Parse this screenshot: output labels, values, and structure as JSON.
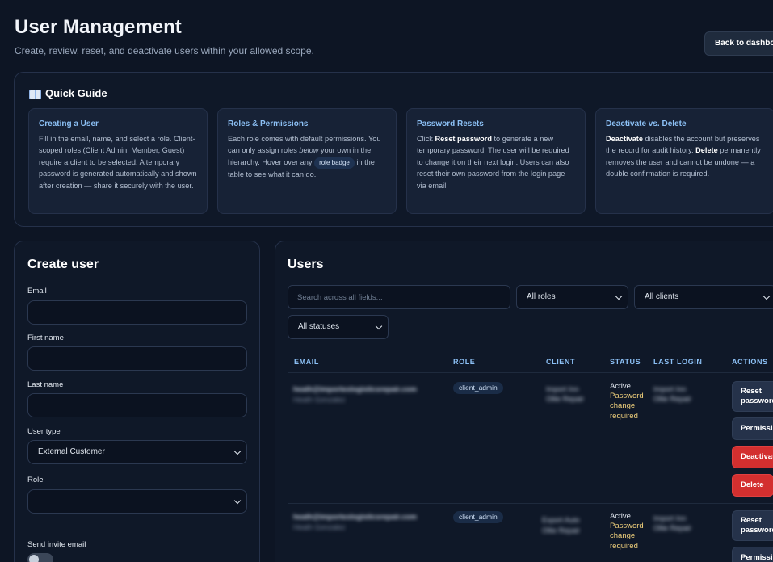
{
  "header": {
    "title": "User Management",
    "subtitle": "Create, review, reset, and deactivate users within your allowed scope.",
    "back_label": "Back to dashboard"
  },
  "guide": {
    "heading": "Quick Guide",
    "icon": "book-icon",
    "cards": [
      {
        "title": "Creating a User",
        "text": "Fill in the email, name, and select a role. Client-scoped roles (Client Admin, Member, Guest) require a client to be selected. A temporary password is generated automatically and shown after creation — share it securely with the user."
      },
      {
        "title": "Roles & Permissions",
        "text_a": "Each role comes with default permissions. You can only assign roles ",
        "text_em": "below",
        "text_b": " your own in the hierarchy. Hover over any ",
        "chip": "role badge",
        "text_c": " in the table to see what it can do."
      },
      {
        "title": "Password Resets",
        "text_a": "Click ",
        "text_bold": "Reset password",
        "text_b": " to generate a new temporary password. The user will be required to change it on their next login. Users can also reset their own password from the login page via email."
      },
      {
        "title": "Deactivate vs. Delete",
        "bold_a": "Deactivate",
        "text_a": " disables the account but preserves the record for audit history. ",
        "bold_b": "Delete",
        "text_b": " permanently removes the user and cannot be undone — a double confirmation is required."
      }
    ]
  },
  "create": {
    "title": "Create user",
    "email_label": "Email",
    "first_label": "First name",
    "last_label": "Last name",
    "type_label": "User type",
    "type_value": "External Customer",
    "role_label": "Role",
    "role_value": "",
    "invite_label": "Send invite email"
  },
  "users": {
    "title": "Users",
    "search_placeholder": "Search across all fields...",
    "filter_roles": "All roles",
    "filter_clients": "All clients",
    "filter_statuses": "All statuses",
    "columns": [
      "EMAIL",
      "ROLE",
      "CLIENT",
      "STATUS",
      "LAST LOGIN",
      "ACTIONS"
    ],
    "rows": [
      {
        "email": "heath@importexlogisticsrepair.com",
        "name": "Heath Gonzalez",
        "role": "client_admin",
        "client_a": "Import Inn",
        "client_b": "Ollie Repair",
        "status": "Active",
        "status_note": "Password change required",
        "login_a": "Import Inn",
        "login_b": "Ollie Repair"
      },
      {
        "email": "heath@importexlogisticsrepair.com",
        "name": "Heath Gonzalez",
        "role": "client_admin",
        "client_a": "Export Auto",
        "client_b": "Ollie Repair",
        "status": "Active",
        "status_note": "Password change required",
        "login_a": "Import Inn",
        "login_b": "Ollie Repair"
      }
    ],
    "actions": {
      "reset": "Reset password",
      "permissions": "Permissions",
      "deactivate": "Deactivate",
      "delete": "Delete"
    }
  }
}
